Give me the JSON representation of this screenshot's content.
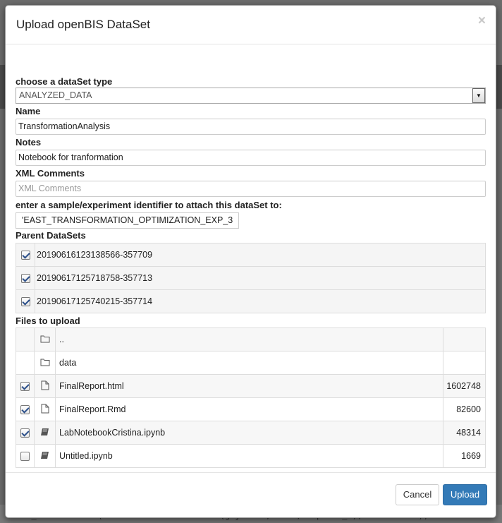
{
  "dialog": {
    "title": "Upload openBIS DataSet",
    "close_label": "×"
  },
  "form": {
    "dataset_type_label": "choose a dataSet type",
    "dataset_type_value": "ANALYZED_DATA",
    "name_label": "Name",
    "name_value": "TransformationAnalysis",
    "notes_label": "Notes",
    "notes_value": "Notebook for tranformation",
    "xml_label": "XML Comments",
    "xml_placeholder": "XML Comments",
    "identifier_label": "enter a sample/experiment identifier to attach this dataSet to:",
    "identifier_value": "'EAST_TRANSFORMATION_OPTIMIZATION_EXP_3"
  },
  "parents": {
    "label": "Parent DataSets",
    "rows": [
      {
        "checked": true,
        "id": "20190616123138566-357709"
      },
      {
        "checked": true,
        "id": "20190617125718758-357713"
      },
      {
        "checked": true,
        "id": "20190617125740215-357714"
      }
    ]
  },
  "files": {
    "label": "Files to upload",
    "rows": [
      {
        "checkbox": false,
        "checked": false,
        "icon": "folder-icon",
        "name": "..",
        "size": ""
      },
      {
        "checkbox": false,
        "checked": false,
        "icon": "folder-icon",
        "name": "data",
        "size": ""
      },
      {
        "checkbox": true,
        "checked": true,
        "icon": "file-icon",
        "name": "FinalReport.html",
        "size": "1602748"
      },
      {
        "checkbox": true,
        "checked": true,
        "icon": "file-icon",
        "name": "FinalReport.Rmd",
        "size": "82600"
      },
      {
        "checkbox": true,
        "checked": true,
        "icon": "notebook-icon",
        "name": "LabNotebookCristina.ipynb",
        "size": "48314"
      },
      {
        "checkbox": true,
        "checked": false,
        "icon": "notebook-icon",
        "name": "Untitled.ipynb",
        "size": "1669"
      }
    ]
  },
  "buttons": {
    "cancel": "Cancel",
    "upload": "Upload"
  },
  "background": {
    "code_line": "df_28 <- mutate(Interaction=Interaction(gsjoined, UmbR, sep = \"_\"), order=TRUE))"
  },
  "colors": {
    "primary": "#337ab7",
    "backdrop": "#6b6b6b"
  }
}
